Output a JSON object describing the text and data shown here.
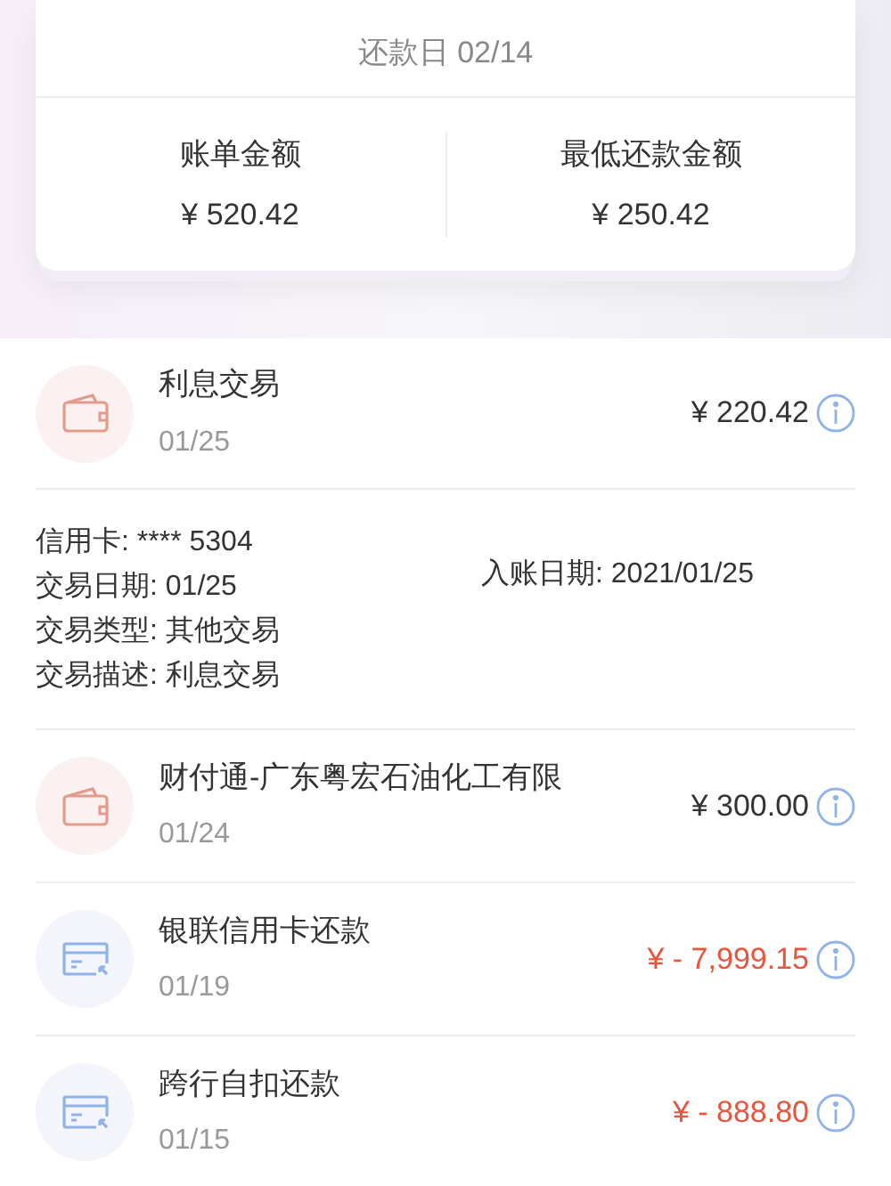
{
  "summary": {
    "due_date": "还款日 02/14",
    "stats": [
      {
        "label": "账单金额",
        "value": "¥ 520.42"
      },
      {
        "label": "最低还款金额",
        "value": "¥ 250.42"
      }
    ]
  },
  "transactions": [
    {
      "kind": "purchase",
      "title": "利息交易",
      "date": "01/25",
      "amount": "¥ 220.42",
      "expanded": true,
      "details": {
        "lines": [
          "信用卡: **** 5304",
          "交易日期: 01/25",
          "交易类型: 其他交易",
          "交易描述: 利息交易"
        ],
        "posted": "入账日期: 2021/01/25"
      }
    },
    {
      "kind": "purchase",
      "title": "财付通-广东粤宏石油化工有限",
      "date": "01/24",
      "amount": "¥ 300.00",
      "expanded": false
    },
    {
      "kind": "repayment",
      "title": "银联信用卡还款",
      "date": "01/19",
      "amount": "¥ - 7,999.15",
      "expanded": false
    },
    {
      "kind": "repayment",
      "title": "跨行自扣还款",
      "date": "01/15",
      "amount": "¥ - 888.80",
      "expanded": false
    }
  ]
}
